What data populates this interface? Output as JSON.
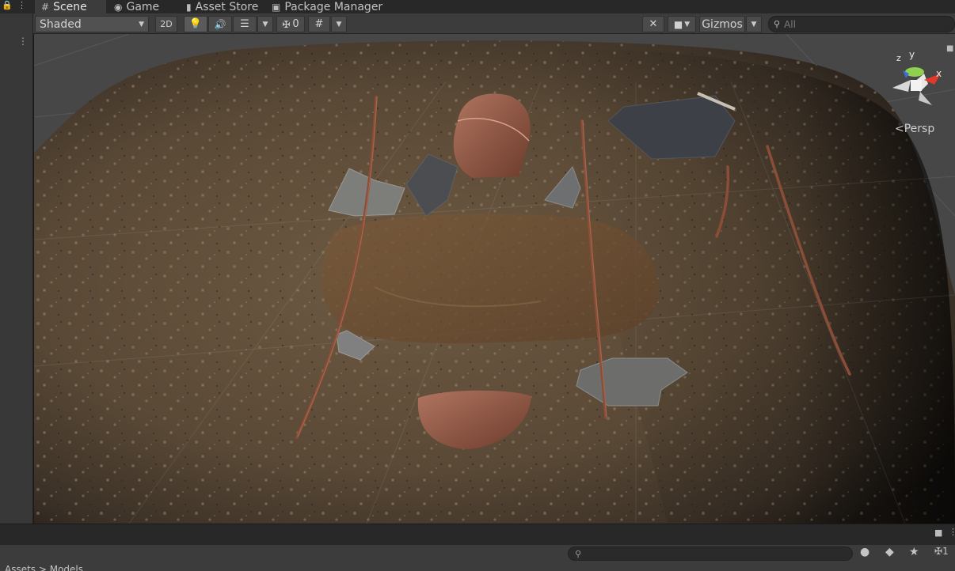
{
  "tabs": [
    {
      "label": "Scene",
      "icon": "#",
      "active": true
    },
    {
      "label": "Game",
      "icon": "gamepad"
    },
    {
      "label": "Asset Store",
      "icon": "bag"
    },
    {
      "label": "Package Manager",
      "icon": "package"
    }
  ],
  "toolbar": {
    "shading_mode": "Shaded",
    "mode_2d": "2D",
    "hidden_count": "0",
    "gizmos_label": "Gizmos",
    "search_placeholder": "All"
  },
  "scene": {
    "projection_label": "Persp",
    "axis_x": "x",
    "axis_y": "y",
    "axis_z": "z"
  },
  "bottom": {
    "hidden_count": "1",
    "breadcrumb": "Assets > Models"
  },
  "colors": {
    "accent_x": "#e0392b",
    "accent_y": "#8fd14f",
    "accent_z": "#3b6cd8",
    "ground": "#5c4b38"
  }
}
